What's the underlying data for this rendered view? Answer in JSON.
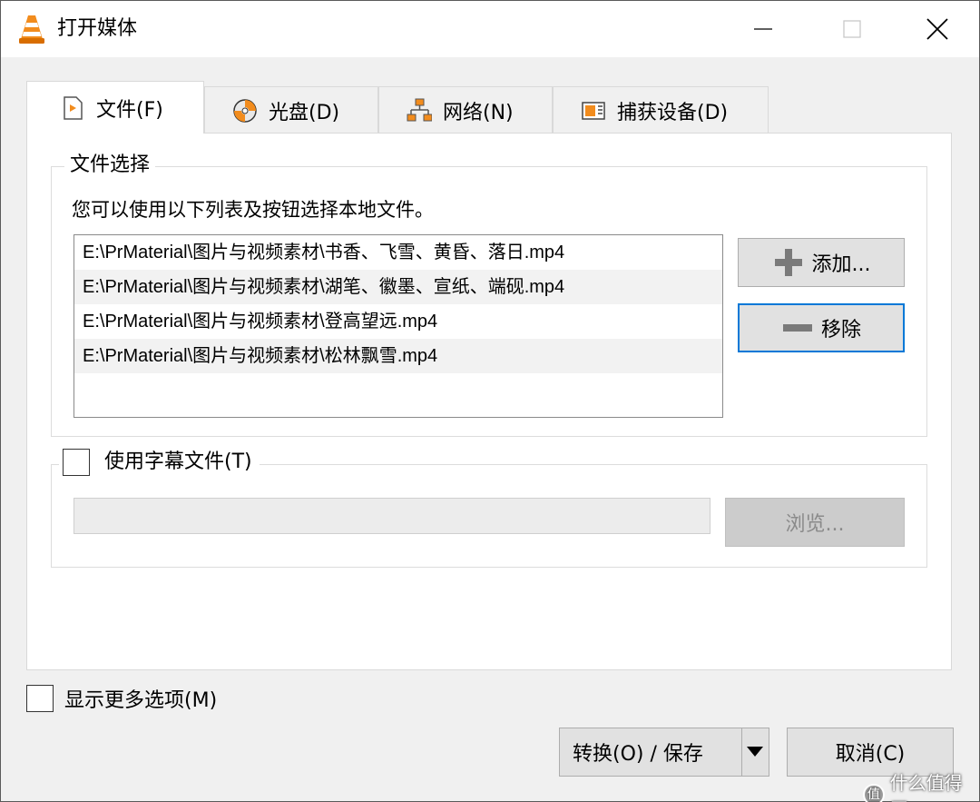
{
  "window": {
    "title": "打开媒体",
    "app_icon": "vlc-cone-icon"
  },
  "tabs": [
    {
      "label": "文件(F)",
      "icon": "file-play-icon",
      "active": true
    },
    {
      "label": "光盘(D)",
      "icon": "disc-icon",
      "active": false
    },
    {
      "label": "网络(N)",
      "icon": "network-icon",
      "active": false
    },
    {
      "label": "捕获设备(D)",
      "icon": "capture-device-icon",
      "active": false
    }
  ],
  "file_group": {
    "legend": "文件选择",
    "description": "您可以使用以下列表及按钮选择本地文件。",
    "files": [
      "E:\\PrMaterial\\图片与视频素材\\书香、飞雪、黄昏、落日.mp4",
      "E:\\PrMaterial\\图片与视频素材\\湖笔、徽墨、宣纸、端砚.mp4",
      "E:\\PrMaterial\\图片与视频素材\\登高望远.mp4",
      "E:\\PrMaterial\\图片与视频素材\\松林飘雪.mp4"
    ],
    "add_label": "添加...",
    "remove_label": "移除"
  },
  "subtitle_group": {
    "checkbox_label": "使用字幕文件(T)",
    "checked": false,
    "path_value": "",
    "browse_label": "浏览..."
  },
  "more_options": {
    "label": "显示更多选项(M)",
    "checked": false
  },
  "footer": {
    "convert_label": "转换(O) / 保存",
    "cancel_label": "取消(C)"
  },
  "watermark": {
    "text": "什么值得买",
    "logo_text": "值"
  },
  "colors": {
    "focus_border": "#0078d7",
    "vlc_orange": "#f28c1d",
    "button_bg": "#e1e1e1"
  }
}
